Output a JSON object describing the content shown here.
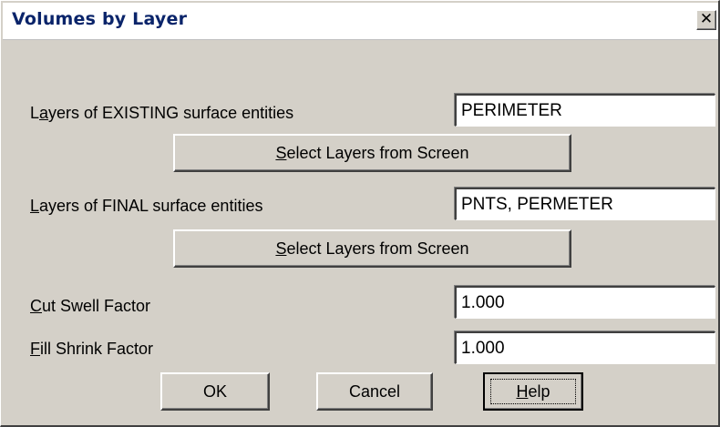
{
  "dialog": {
    "title": "Volumes by Layer",
    "close_glyph": "✕"
  },
  "existing": {
    "label_prefix": "L",
    "label_accel": "a",
    "label_rest": "yers of EXISTING surface entities",
    "value": "PERIMETER",
    "select_button_accel": "S",
    "select_button_rest": "elect Layers from Screen"
  },
  "final": {
    "label_prefix": "",
    "label_accel": "L",
    "label_rest": "ayers of FINAL surface entities",
    "value": "PNTS, PERMETER",
    "select_button_accel": "S",
    "select_button_rest": "elect Layers from Screen"
  },
  "cut_swell": {
    "label_accel": "C",
    "label_rest": "ut Swell Factor",
    "value": "1.000"
  },
  "fill_shrink": {
    "label_accel": "F",
    "label_rest": "ill Shrink Factor",
    "value": "1.000"
  },
  "buttons": {
    "ok": "OK",
    "cancel": "Cancel",
    "help_accel": "H",
    "help_rest": "elp"
  },
  "icons": {
    "close": "close-icon"
  }
}
